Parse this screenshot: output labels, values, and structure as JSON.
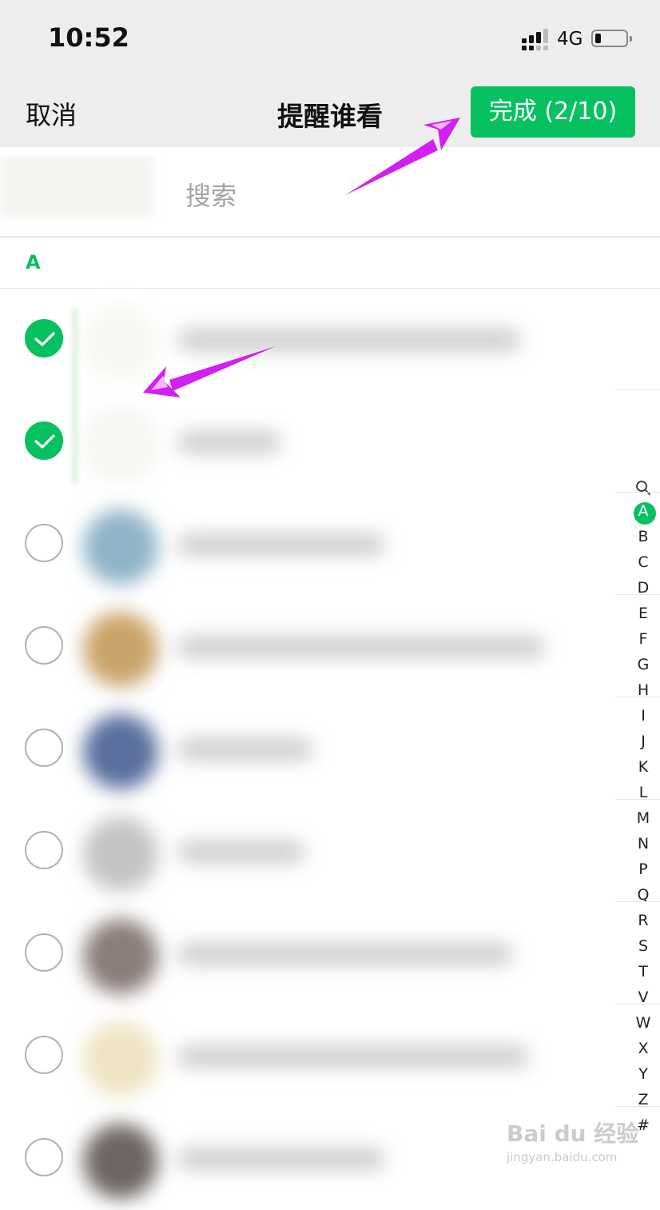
{
  "status_bar": {
    "time": "10:52",
    "network": "4G"
  },
  "nav": {
    "cancel_label": "取消",
    "title": "提醒谁看",
    "done_label": "完成 (2/10)"
  },
  "search": {
    "placeholder": "搜索"
  },
  "section_header": "A",
  "contacts": [
    {
      "checked": true,
      "avatar_color": "#f6f6f2",
      "name_width": 430
    },
    {
      "checked": true,
      "avatar_color": "#f4f6f2",
      "name_width": 130
    },
    {
      "checked": false,
      "avatar_color": "#8fb3c7",
      "name_width": 260
    },
    {
      "checked": false,
      "avatar_color": "#c9a46a",
      "name_width": 460
    },
    {
      "checked": false,
      "avatar_color": "#5a6f9e",
      "name_width": 170
    },
    {
      "checked": false,
      "avatar_color": "#c4c4c4",
      "name_width": 160
    },
    {
      "checked": false,
      "avatar_color": "#8a7d7a",
      "name_width": 420
    },
    {
      "checked": false,
      "avatar_color": "#efe3c4",
      "name_width": 440
    },
    {
      "checked": false,
      "avatar_color": "#6e6663",
      "name_width": 260
    }
  ],
  "index_bar": [
    "search",
    "A",
    "B",
    "C",
    "D",
    "E",
    "F",
    "G",
    "H",
    "I",
    "J",
    "K",
    "L",
    "M",
    "N",
    "P",
    "Q",
    "R",
    "S",
    "T",
    "V",
    "W",
    "X",
    "Y",
    "Z",
    "#"
  ],
  "index_active": "A",
  "colors": {
    "accent": "#07c160",
    "arrow": "#d21ff2"
  },
  "watermark": {
    "main": "Bai du 经验",
    "sub": "jingyan.baidu.com"
  }
}
